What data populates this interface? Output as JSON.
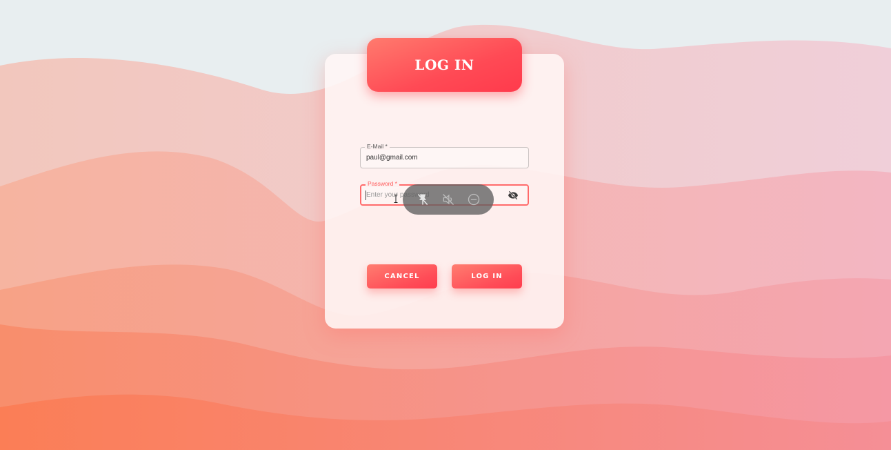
{
  "header": {
    "title": "LOG IN"
  },
  "form": {
    "email": {
      "label": "E-Mail *",
      "value": "paul@gmail.com"
    },
    "password": {
      "label": "Password *",
      "placeholder": "Enter your password",
      "value": ""
    }
  },
  "overlay": {
    "icons": [
      "pin-off-icon",
      "volume-off-icon",
      "minus-circle-icon"
    ]
  },
  "buttons": {
    "cancel_label": "CANCEL",
    "login_label": "LOG IN"
  },
  "colors": {
    "accent": "#ff4a55",
    "accent_light": "#ff7b6e",
    "focus_border": "#ff6a6a",
    "card_bg": "#fff6f5"
  }
}
